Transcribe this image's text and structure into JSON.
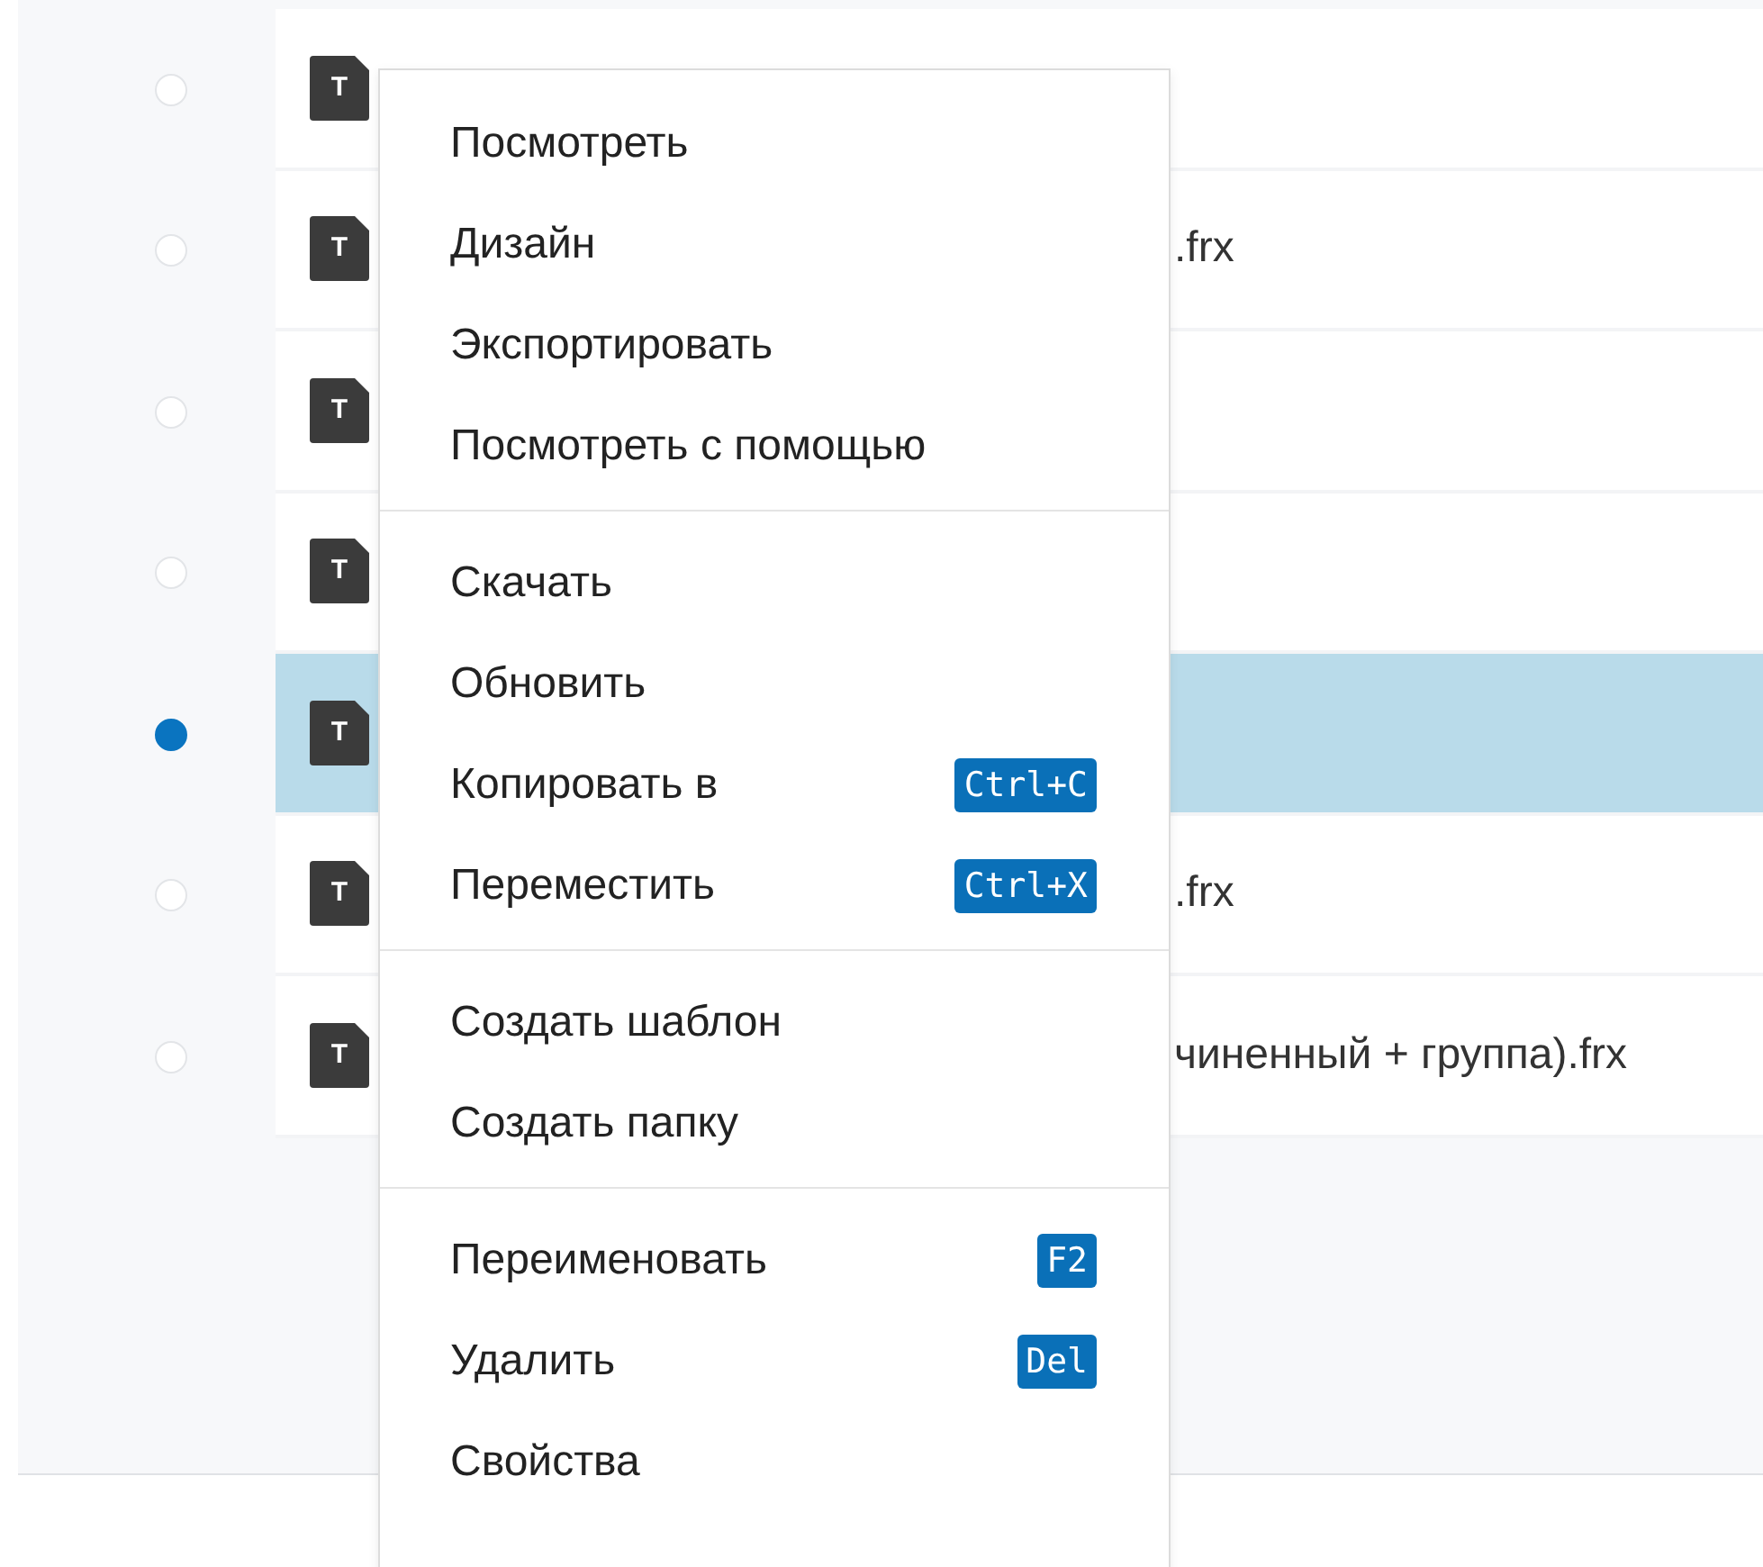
{
  "rows": [
    {
      "selected": false,
      "icon_letter": "T"
    },
    {
      "selected": false,
      "icon_letter": "T",
      "name": ".frx"
    },
    {
      "selected": false,
      "icon_letter": "T"
    },
    {
      "selected": false,
      "icon_letter": "T"
    },
    {
      "selected": true,
      "icon_letter": "T"
    },
    {
      "selected": false,
      "icon_letter": "T",
      "name": ".frx"
    },
    {
      "selected": false,
      "icon_letter": "T",
      "name": "чиненный + группа).frx"
    }
  ],
  "context_menu": {
    "groups": [
      [
        {
          "label": "Посмотреть"
        },
        {
          "label": "Дизайн"
        },
        {
          "label": "Экспортировать"
        },
        {
          "label": "Посмотреть с помощью"
        }
      ],
      [
        {
          "label": "Скачать"
        },
        {
          "label": "Обновить"
        },
        {
          "label": "Копировать в",
          "shortcut": "Ctrl+C"
        },
        {
          "label": "Переместить",
          "shortcut": "Ctrl+X"
        }
      ],
      [
        {
          "label": "Создать шаблон"
        },
        {
          "label": "Создать папку"
        }
      ],
      [
        {
          "label": "Переименовать",
          "shortcut": "F2"
        },
        {
          "label": "Удалить",
          "shortcut": "Del"
        },
        {
          "label": "Свойства"
        }
      ]
    ]
  }
}
